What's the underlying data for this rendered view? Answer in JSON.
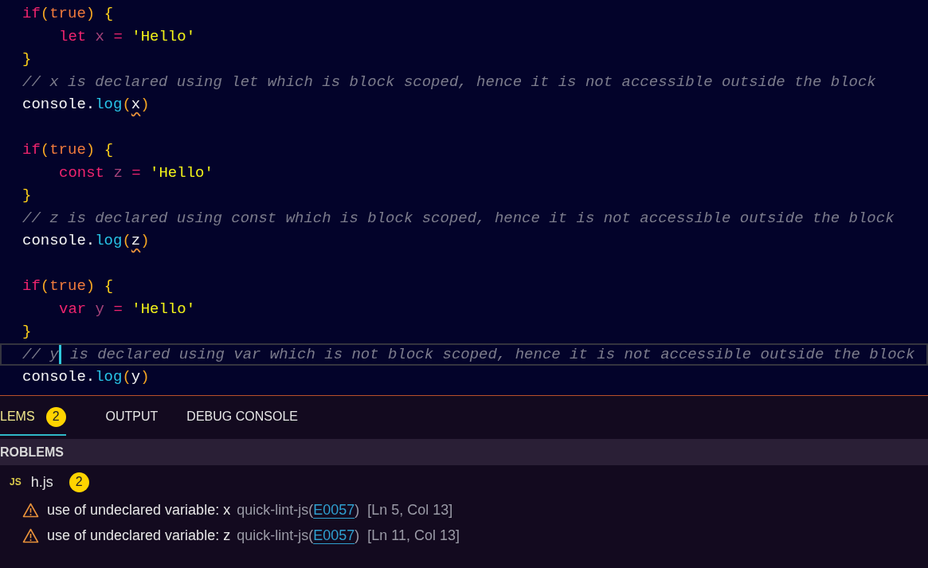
{
  "editor": {
    "lines": [
      {
        "kind": "code",
        "indented": false,
        "tokens": [
          {
            "kind": "keyword",
            "text": "if"
          },
          {
            "kind": "paren",
            "text": "("
          },
          {
            "kind": "literal",
            "text": "true"
          },
          {
            "kind": "paren",
            "text": ")"
          },
          {
            "kind": "brace",
            "text": " {"
          }
        ]
      },
      {
        "kind": "code",
        "indented": true,
        "tokens": [
          {
            "kind": "keyword",
            "text": "let"
          },
          {
            "kind": "variable",
            "text": " x"
          },
          {
            "kind": "operator",
            "text": " ="
          },
          {
            "kind": "string",
            "text": " 'Hello'"
          }
        ]
      },
      {
        "kind": "code",
        "indented": false,
        "tokens": [
          {
            "kind": "brace",
            "text": "}"
          }
        ]
      },
      {
        "kind": "code",
        "indented": false,
        "tokens": [
          {
            "kind": "comment",
            "text": "// x is declared using let which is block scoped, hence it is not accessible outside the block"
          }
        ]
      },
      {
        "kind": "code",
        "indented": false,
        "tokens": [
          {
            "kind": "object",
            "text": "console."
          },
          {
            "kind": "method",
            "text": "log"
          },
          {
            "kind": "paren",
            "text": "("
          },
          {
            "kind": "error",
            "text": "x"
          },
          {
            "kind": "paren",
            "text": ")"
          }
        ]
      },
      {
        "kind": "blank"
      },
      {
        "kind": "code",
        "indented": false,
        "tokens": [
          {
            "kind": "keyword",
            "text": "if"
          },
          {
            "kind": "paren",
            "text": "("
          },
          {
            "kind": "literal",
            "text": "true"
          },
          {
            "kind": "paren",
            "text": ")"
          },
          {
            "kind": "brace",
            "text": " {"
          }
        ]
      },
      {
        "kind": "code",
        "indented": true,
        "tokens": [
          {
            "kind": "keyword",
            "text": "const"
          },
          {
            "kind": "variable",
            "text": " z"
          },
          {
            "kind": "operator",
            "text": " ="
          },
          {
            "kind": "string",
            "text": " 'Hello'"
          }
        ]
      },
      {
        "kind": "code",
        "indented": false,
        "tokens": [
          {
            "kind": "brace",
            "text": "}"
          }
        ]
      },
      {
        "kind": "code",
        "indented": false,
        "tokens": [
          {
            "kind": "comment",
            "text": "// z is declared using const which is block scoped, hence it is not accessible outside the block"
          }
        ]
      },
      {
        "kind": "code",
        "indented": false,
        "tokens": [
          {
            "kind": "object",
            "text": "console."
          },
          {
            "kind": "method",
            "text": "log"
          },
          {
            "kind": "paren",
            "text": "("
          },
          {
            "kind": "error",
            "text": "z"
          },
          {
            "kind": "paren",
            "text": ")"
          }
        ]
      },
      {
        "kind": "blank"
      },
      {
        "kind": "code",
        "indented": false,
        "tokens": [
          {
            "kind": "keyword",
            "text": "if"
          },
          {
            "kind": "paren",
            "text": "("
          },
          {
            "kind": "literal",
            "text": "true"
          },
          {
            "kind": "paren",
            "text": ")"
          },
          {
            "kind": "brace",
            "text": " {"
          }
        ]
      },
      {
        "kind": "code",
        "indented": true,
        "tokens": [
          {
            "kind": "keyword",
            "text": "var"
          },
          {
            "kind": "variable",
            "text": " y"
          },
          {
            "kind": "operator",
            "text": " ="
          },
          {
            "kind": "string",
            "text": " 'Hello'"
          }
        ]
      },
      {
        "kind": "code",
        "indented": false,
        "tokens": [
          {
            "kind": "brace",
            "text": "}"
          }
        ]
      },
      {
        "kind": "current",
        "indented": false,
        "tokens": [
          {
            "kind": "comment",
            "text": "// y"
          },
          {
            "kind": "cursor"
          },
          {
            "kind": "comment",
            "text": " is declared using var which is not block scoped, hence it is not accessible outside the block"
          }
        ]
      },
      {
        "kind": "code",
        "indented": false,
        "tokens": [
          {
            "kind": "object",
            "text": "console."
          },
          {
            "kind": "method",
            "text": "log"
          },
          {
            "kind": "paren",
            "text": "("
          },
          {
            "kind": "object",
            "text": "y"
          },
          {
            "kind": "paren",
            "text": ")"
          }
        ]
      }
    ]
  },
  "panel": {
    "tabs": [
      {
        "label": "LEMS",
        "badge": "2",
        "selected": true
      },
      {
        "label": "OUTPUT",
        "selected": false
      },
      {
        "label": "DEBUG CONSOLE",
        "selected": false
      }
    ],
    "section_title": "ROBLEMS",
    "file": {
      "icon_label": "JS",
      "name": "h.js",
      "badge": "2"
    },
    "problems": [
      {
        "message": "use of undeclared variable: x",
        "source": "quick-lint-js(",
        "code": "E0057",
        "source_end": ")",
        "location": "[Ln 5, Col 13]"
      },
      {
        "message": "use of undeclared variable: z",
        "source": "quick-lint-js(",
        "code": "E0057",
        "source_end": ")",
        "location": "[Ln 11, Col 13]"
      }
    ]
  }
}
